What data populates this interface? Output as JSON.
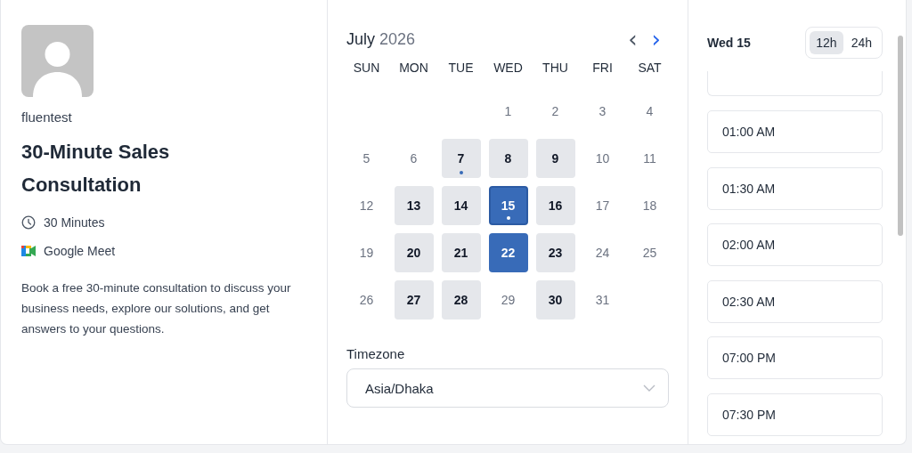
{
  "host": {
    "name": "fluentest"
  },
  "event": {
    "title": "30-Minute Sales Consultation",
    "duration": "30 Minutes",
    "location": "Google Meet",
    "description": "Book a free 30-minute consultation to discuss your business needs, explore our solutions, and get answers to your questions."
  },
  "calendar": {
    "month": "July",
    "year": "2026",
    "prev_button": "‹",
    "next_button": "›",
    "weekdays": [
      "SUN",
      "MON",
      "TUE",
      "WED",
      "THU",
      "FRI",
      "SAT"
    ],
    "weeks": [
      [
        {
          "kind": "blank"
        },
        {
          "kind": "blank"
        },
        {
          "kind": "blank"
        },
        {
          "kind": "day",
          "day": "1",
          "available": false,
          "selected": false,
          "highlighted": false,
          "dot": false
        },
        {
          "kind": "day",
          "day": "2",
          "available": false,
          "selected": false,
          "highlighted": false,
          "dot": false
        },
        {
          "kind": "day",
          "day": "3",
          "available": false,
          "selected": false,
          "highlighted": false,
          "dot": false
        },
        {
          "kind": "day",
          "day": "4",
          "available": false,
          "selected": false,
          "highlighted": false,
          "dot": false
        }
      ],
      [
        {
          "kind": "day",
          "day": "5",
          "available": false,
          "selected": false,
          "highlighted": false,
          "dot": false
        },
        {
          "kind": "day",
          "day": "6",
          "available": false,
          "selected": false,
          "highlighted": false,
          "dot": false
        },
        {
          "kind": "day",
          "day": "7",
          "available": true,
          "selected": false,
          "highlighted": false,
          "dot": true
        },
        {
          "kind": "day",
          "day": "8",
          "available": true,
          "selected": false,
          "highlighted": false,
          "dot": false
        },
        {
          "kind": "day",
          "day": "9",
          "available": true,
          "selected": false,
          "highlighted": false,
          "dot": false
        },
        {
          "kind": "day",
          "day": "10",
          "available": false,
          "selected": false,
          "highlighted": false,
          "dot": false
        },
        {
          "kind": "day",
          "day": "11",
          "available": false,
          "selected": false,
          "highlighted": false,
          "dot": false
        }
      ],
      [
        {
          "kind": "day",
          "day": "12",
          "available": false,
          "selected": false,
          "highlighted": false,
          "dot": false
        },
        {
          "kind": "day",
          "day": "13",
          "available": true,
          "selected": false,
          "highlighted": false,
          "dot": false
        },
        {
          "kind": "day",
          "day": "14",
          "available": true,
          "selected": false,
          "highlighted": false,
          "dot": false
        },
        {
          "kind": "day",
          "day": "15",
          "available": true,
          "selected": true,
          "highlighted": false,
          "dot": true
        },
        {
          "kind": "day",
          "day": "16",
          "available": true,
          "selected": false,
          "highlighted": false,
          "dot": false
        },
        {
          "kind": "day",
          "day": "17",
          "available": false,
          "selected": false,
          "highlighted": false,
          "dot": false
        },
        {
          "kind": "day",
          "day": "18",
          "available": false,
          "selected": false,
          "highlighted": false,
          "dot": false
        }
      ],
      [
        {
          "kind": "day",
          "day": "19",
          "available": false,
          "selected": false,
          "highlighted": false,
          "dot": false
        },
        {
          "kind": "day",
          "day": "20",
          "available": true,
          "selected": false,
          "highlighted": false,
          "dot": false
        },
        {
          "kind": "day",
          "day": "21",
          "available": true,
          "selected": false,
          "highlighted": false,
          "dot": false
        },
        {
          "kind": "day",
          "day": "22",
          "available": true,
          "selected": false,
          "highlighted": true,
          "dot": false
        },
        {
          "kind": "day",
          "day": "23",
          "available": true,
          "selected": false,
          "highlighted": false,
          "dot": false
        },
        {
          "kind": "day",
          "day": "24",
          "available": false,
          "selected": false,
          "highlighted": false,
          "dot": false
        },
        {
          "kind": "day",
          "day": "25",
          "available": false,
          "selected": false,
          "highlighted": false,
          "dot": false
        }
      ],
      [
        {
          "kind": "day",
          "day": "26",
          "available": false,
          "selected": false,
          "highlighted": false,
          "dot": false
        },
        {
          "kind": "day",
          "day": "27",
          "available": true,
          "selected": false,
          "highlighted": false,
          "dot": false
        },
        {
          "kind": "day",
          "day": "28",
          "available": true,
          "selected": false,
          "highlighted": false,
          "dot": false
        },
        {
          "kind": "day",
          "day": "29",
          "available": false,
          "selected": false,
          "highlighted": false,
          "dot": false
        },
        {
          "kind": "day",
          "day": "30",
          "available": true,
          "selected": false,
          "highlighted": false,
          "dot": false
        },
        {
          "kind": "day",
          "day": "31",
          "available": false,
          "selected": false,
          "highlighted": false,
          "dot": false
        }
      ]
    ]
  },
  "timezone": {
    "label": "Timezone",
    "value": "Asia/Dhaka"
  },
  "slots": {
    "date": "Wed 15",
    "formats": [
      {
        "label": "12h",
        "selected": true
      },
      {
        "label": "24h",
        "selected": false
      }
    ],
    "times": [
      "01:00 AM",
      "01:30 AM",
      "02:00 AM",
      "02:30 AM",
      "07:00 PM",
      "07:30 PM"
    ]
  }
}
